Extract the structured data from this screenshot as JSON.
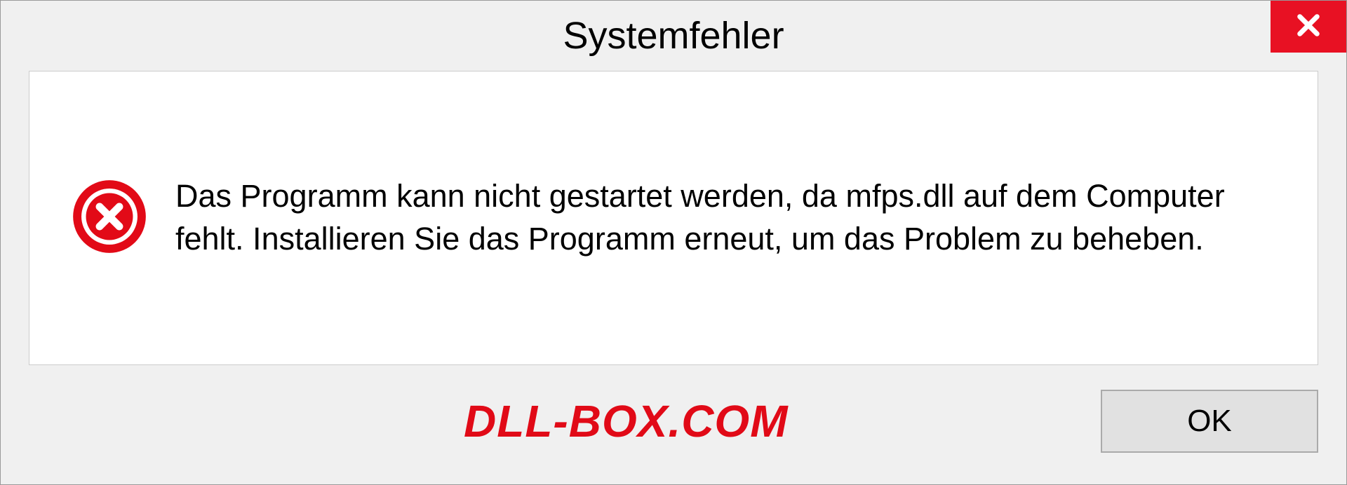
{
  "dialog": {
    "title": "Systemfehler",
    "message": "Das Programm kann nicht gestartet werden, da mfps.dll auf dem Computer fehlt. Installieren Sie das Programm erneut, um das Problem zu beheben.",
    "ok_label": "OK",
    "watermark": "DLL-BOX.COM"
  }
}
